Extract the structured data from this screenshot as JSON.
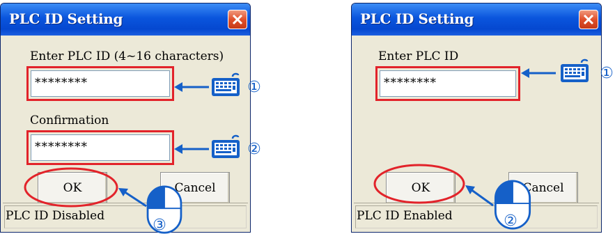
{
  "dialog1": {
    "title": "PLC ID Setting",
    "enter_label": "Enter PLC ID (4~16 characters)",
    "enter_value": "********",
    "confirm_label": "Confirmation",
    "confirm_value": "********",
    "ok_label": "OK",
    "cancel_label": "Cancel",
    "status": "PLC ID Disabled",
    "step_markers": [
      "①",
      "②",
      "③"
    ]
  },
  "dialog2": {
    "title": "PLC ID Setting",
    "enter_label": "Enter PLC ID",
    "enter_value": "********",
    "ok_label": "OK",
    "cancel_label": "Cancel",
    "status": "PLC ID Enabled",
    "step_markers": [
      "①",
      "②"
    ]
  },
  "colors": {
    "highlight_red": "#e2232a",
    "arrow_blue": "#1560c8",
    "titlebar_blue": "#0a55dd"
  },
  "icons": [
    "close-icon",
    "keyboard-icon",
    "mouse-icon",
    "arrow-icon"
  ]
}
